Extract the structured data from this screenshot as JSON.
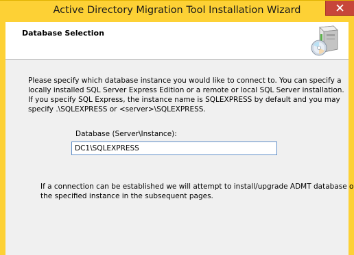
{
  "window": {
    "title": "Active Directory Migration Tool Installation Wizard",
    "close_icon": "close-x-icon"
  },
  "header": {
    "title": "Database Selection",
    "icon": "setup-box-cd-icon"
  },
  "instruction": {
    "lines": [
      "Please specify which database instance you would like to connect to. You can specify a",
      "locally installed SQL Server Express Edition or a remote or local SQL Server installation.",
      "If you specify SQL Express, the instance name is SQLEXPRESS by default and you may",
      "specify .\\SQLEXPRESS or <server>\\SQLEXPRESS."
    ]
  },
  "database": {
    "label": "Database (Server\\Instance):",
    "value": "DC1\\SQLEXPRESS"
  },
  "note": {
    "lines": [
      "If a connection can be established we will attempt to install/upgrade ADMT database on",
      "the specified instance in the subsequent pages."
    ]
  },
  "colors": {
    "titlebar": "#fdd135",
    "close_button": "#c7463a",
    "input_border": "#5a8ac6"
  }
}
